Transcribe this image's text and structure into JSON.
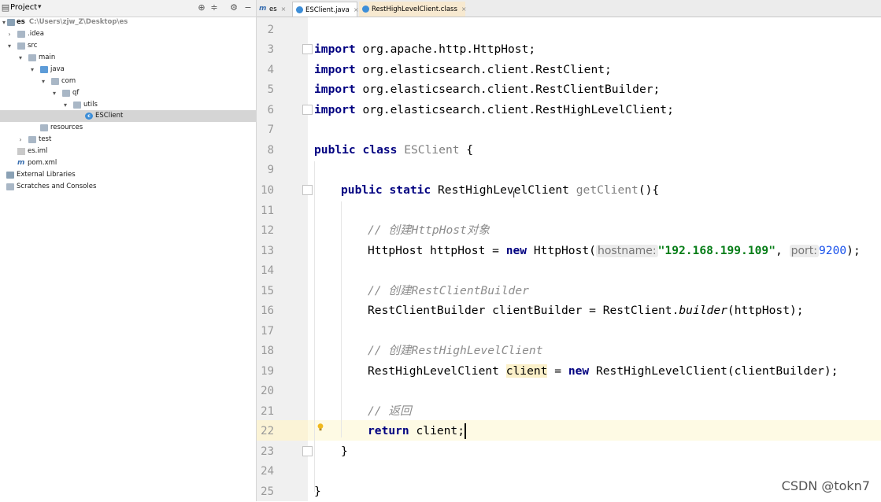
{
  "project_panel": {
    "title": "Project",
    "tree": [
      {
        "label": "es",
        "path": "C:\\Users\\zjw_Z\\Desktop\\es"
      },
      {
        "label": ".idea"
      },
      {
        "label": "src"
      },
      {
        "label": "main"
      },
      {
        "label": "java"
      },
      {
        "label": "com"
      },
      {
        "label": "qf"
      },
      {
        "label": "utils"
      },
      {
        "label": "ESClient"
      },
      {
        "label": "resources"
      },
      {
        "label": "test"
      },
      {
        "label": "es.iml"
      },
      {
        "label": "pom.xml"
      },
      {
        "label": "External Libraries"
      },
      {
        "label": "Scratches and Consoles"
      }
    ]
  },
  "tabs": [
    {
      "label": "es"
    },
    {
      "label": "ESClient.java"
    },
    {
      "label": "RestHighLevelClient.class"
    }
  ],
  "editor": {
    "line_numbers": [
      "2",
      "3",
      "4",
      "5",
      "6",
      "7",
      "8",
      "9",
      "10",
      "11",
      "12",
      "13",
      "14",
      "15",
      "16",
      "17",
      "18",
      "19",
      "20",
      "21",
      "22",
      "23",
      "24",
      "25"
    ],
    "code": {
      "l3_kw": "import",
      "l3_rest": " org.apache.http.HttpHost;",
      "l4_kw": "import",
      "l4_rest": " org.elasticsearch.client.RestClient;",
      "l5_kw": "import",
      "l5_rest": " org.elasticsearch.client.RestClientBuilder;",
      "l6_kw": "import",
      "l6_rest": " org.elasticsearch.client.RestHighLevelClient;",
      "l8_kw": "public class",
      "l8_name": " ESClient",
      "l8_rest": " {",
      "l10_kw": "public static",
      "l10_type": " RestHighLevelClient",
      "l10_method": " getClient",
      "l10_rest": "(){",
      "l12_comment": "// 创建HttpHost对象",
      "l13_a": "HttpHost httpHost = ",
      "l13_new": "new",
      "l13_b": " HttpHost(",
      "l13_hint1": "hostname:",
      "l13_str": "\"192.168.199.109\"",
      "l13_c": ", ",
      "l13_hint2": "port:",
      "l13_num": "9200",
      "l13_d": ");",
      "l15_comment": "// 创建RestClientBuilder",
      "l16_a": "RestClientBuilder clientBuilder = RestClient.",
      "l16_italic": "builder",
      "l16_b": "(httpHost);",
      "l18_comment": "// 创建RestHighLevelClient",
      "l19_a": "RestHighLevelClient ",
      "l19_var": "client",
      "l19_b": " = ",
      "l19_new": "new",
      "l19_c": " RestHighLevelClient(clientBuilder);",
      "l21_comment": "// 返回",
      "l22_kw": "return",
      "l22_rest": " client;",
      "l23": "}",
      "l25": "}"
    }
  },
  "watermark": "CSDN @tokn7"
}
